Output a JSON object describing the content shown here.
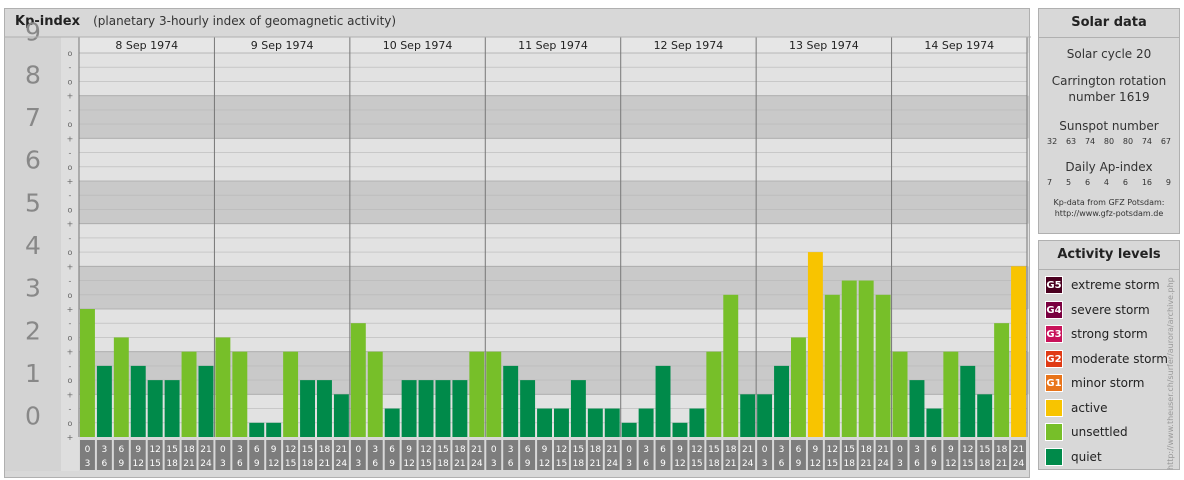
{
  "header": {
    "title": "Kp-index",
    "subtitle": "(planetary 3-hourly index of geomagnetic activity)"
  },
  "chart_data": {
    "type": "bar",
    "title": "Kp-index",
    "subtitle": "(planetary 3-hourly index of geomagnetic activity)",
    "ylim": [
      0,
      9
    ],
    "y_ticks": [
      "0",
      "1",
      "2",
      "3",
      "4",
      "5",
      "6",
      "7",
      "8",
      "9"
    ],
    "minor_tick_labels": [
      "+",
      "o",
      "-"
    ],
    "days": [
      "8 Sep 1974",
      "9 Sep 1974",
      "10 Sep 1974",
      "11 Sep 1974",
      "12 Sep 1974",
      "13 Sep 1974",
      "14 Sep 1974"
    ],
    "interval_start": [
      "0",
      "3",
      "6",
      "9",
      "12",
      "15",
      "18",
      "21"
    ],
    "interval_end": [
      "3",
      "6",
      "9",
      "12",
      "15",
      "18",
      "21",
      "24"
    ],
    "values": [
      [
        3.0,
        1.667,
        2.333,
        1.667,
        1.333,
        1.333,
        2.0,
        1.667
      ],
      [
        2.333,
        2.0,
        0.333,
        0.333,
        2.0,
        1.333,
        1.333,
        1.0
      ],
      [
        2.667,
        2.0,
        0.667,
        1.333,
        1.333,
        1.333,
        1.333,
        2.0
      ],
      [
        2.0,
        1.667,
        1.333,
        0.667,
        0.667,
        1.333,
        0.667,
        0.667
      ],
      [
        0.333,
        0.667,
        1.667,
        0.333,
        0.667,
        2.0,
        3.333,
        1.0
      ],
      [
        1.0,
        1.667,
        2.333,
        4.333,
        3.333,
        3.667,
        3.667,
        3.333
      ],
      [
        2.0,
        1.333,
        0.667,
        2.0,
        1.667,
        1.0,
        2.667,
        4.0
      ]
    ],
    "levels": [
      {
        "label": "quiet",
        "color": "#008a4a"
      },
      {
        "label": "unsettled",
        "color": "#77bf29"
      },
      {
        "label": "active",
        "color": "#f8c400"
      }
    ],
    "grid": true
  },
  "solar": {
    "heading": "Solar data",
    "cycle": "Solar cycle 20",
    "carrington": "Carrington rotation number 1619",
    "sunspot_label": "Sunspot number",
    "sunspot_values": [
      "32",
      "63",
      "74",
      "80",
      "80",
      "74",
      "67"
    ],
    "ap_label": "Daily Ap-index",
    "ap_values": [
      "7",
      "5",
      "6",
      "4",
      "6",
      "16",
      "9"
    ],
    "credit_line1": "Kp-data from GFZ Potsdam:",
    "credit_line2": "http://www.gfz-potsdam.de"
  },
  "activity": {
    "heading": "Activity levels",
    "items": [
      {
        "code": "G5",
        "label": "extreme storm",
        "color": "#4a0020"
      },
      {
        "code": "G4",
        "label": "severe storm",
        "color": "#7a0040"
      },
      {
        "code": "G3",
        "label": "strong storm",
        "color": "#c8125a"
      },
      {
        "code": "G2",
        "label": "moderate storm",
        "color": "#e03a14"
      },
      {
        "code": "G1",
        "label": "minor storm",
        "color": "#e8741a"
      },
      {
        "code": "",
        "label": "active",
        "color": "#f8c400"
      },
      {
        "code": "",
        "label": "unsettled",
        "color": "#77bf29"
      },
      {
        "code": "",
        "label": "quiet",
        "color": "#008a4a"
      }
    ]
  },
  "watermark": "http://www.theuser.ch/surfer/aurora/archive.php"
}
